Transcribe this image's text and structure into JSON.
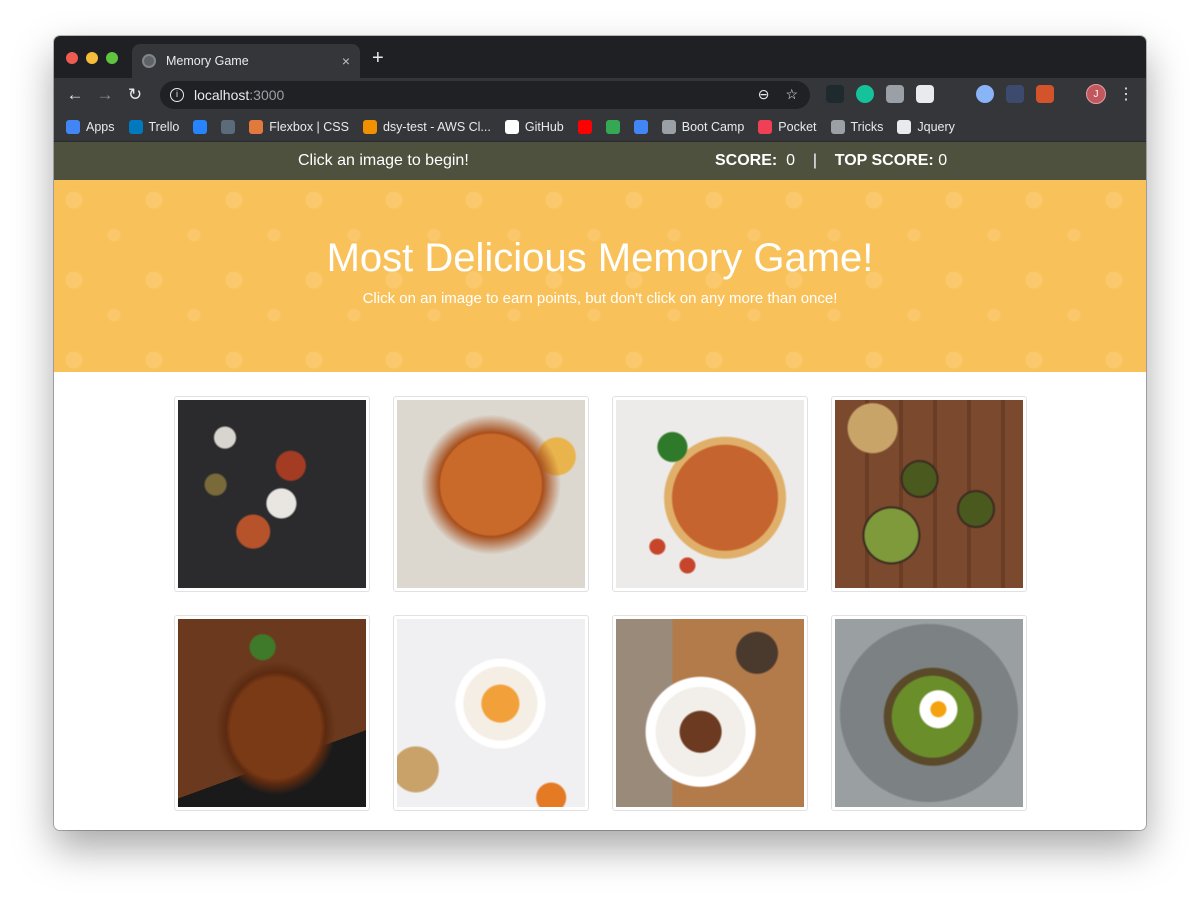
{
  "browser": {
    "tab_title": "Memory Game",
    "tab_close": "×",
    "new_tab": "+",
    "url_host": "localhost",
    "url_port": ":3000",
    "profile_initial": "J",
    "bookmarks": [
      {
        "label": "Apps",
        "color": "#4285f4"
      },
      {
        "label": "Trello",
        "color": "#0079bf"
      },
      {
        "label": "",
        "color": "#2684ff"
      },
      {
        "label": "",
        "color": "#5c6b7a"
      },
      {
        "label": "Flexbox | CSS",
        "color": "#e07a3d"
      },
      {
        "label": "dsy-test - AWS Cl...",
        "color": "#f29100"
      },
      {
        "label": "GitHub",
        "color": "#ffffff"
      },
      {
        "label": "",
        "color": "#ff0000"
      },
      {
        "label": "",
        "color": "#34a853"
      },
      {
        "label": "",
        "color": "#4285f4"
      },
      {
        "label": "Boot Camp",
        "color": "#9aa0a6"
      },
      {
        "label": "Pocket",
        "color": "#ef4056"
      },
      {
        "label": "Tricks",
        "color": "#9aa0a6"
      },
      {
        "label": "Jquery",
        "color": "#e8eaed"
      }
    ]
  },
  "navbar": {
    "message": "Click an image to begin!",
    "score_label": "SCORE:",
    "score": "0",
    "separator": "|",
    "top_score_label": "TOP SCORE:",
    "top_score": "0"
  },
  "hero": {
    "title": "Most Delicious Memory Game!",
    "subtitle": "Click on an image to earn points, but don't click on any more than once!"
  },
  "colors": {
    "navbar_bg": "#4e513e",
    "hero_bg": "#f9c15a"
  },
  "cards": [
    {
      "name": "spices-image"
    },
    {
      "name": "sweet-potato-fries-image"
    },
    {
      "name": "pizza-image"
    },
    {
      "name": "matcha-tea-image"
    },
    {
      "name": "grilled-fish-image"
    },
    {
      "name": "fruit-yogurt-bowl-image"
    },
    {
      "name": "granola-yogurt-image"
    },
    {
      "name": "avocado-toast-egg-image"
    }
  ]
}
